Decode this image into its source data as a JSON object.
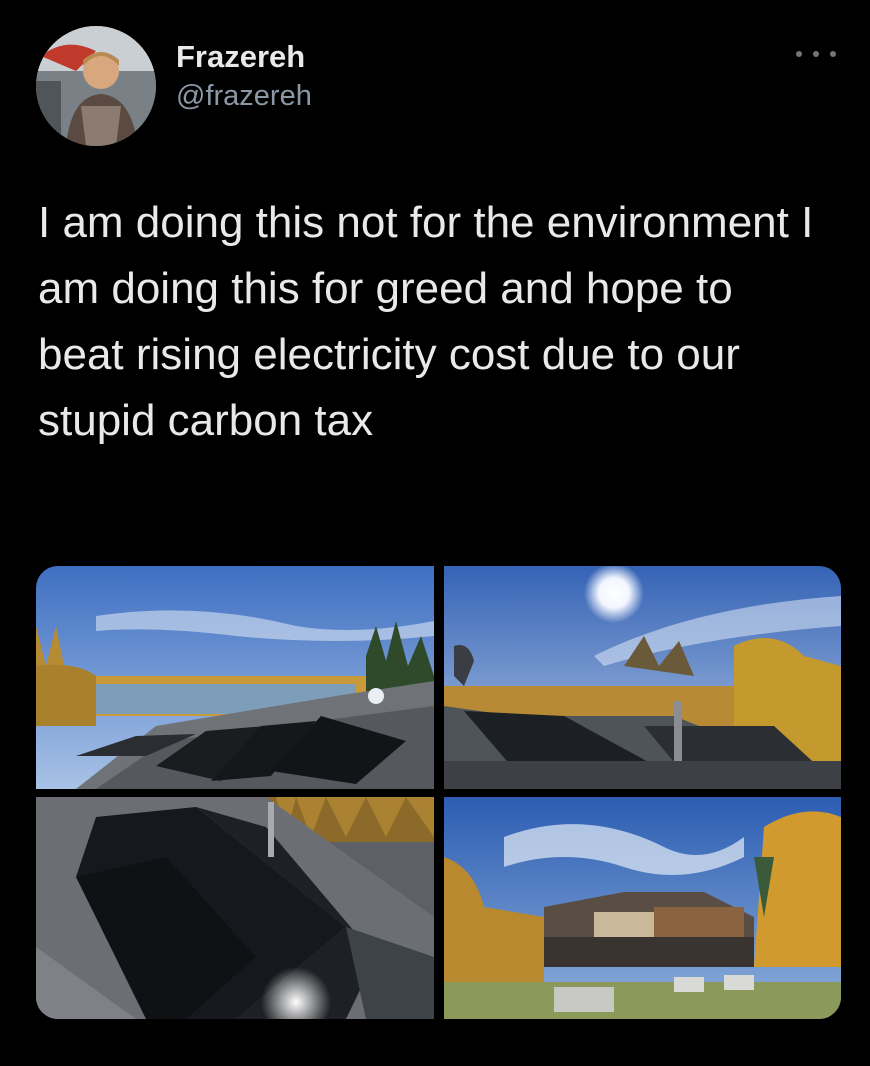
{
  "user": {
    "display_name": "Frazereh",
    "handle": "@frazereh",
    "avatar_icon": "user-avatar-photo"
  },
  "menu": {
    "icon": "more-options-icon"
  },
  "tweet": {
    "text": "I am doing this not for the environment I am doing this for greed and hope to beat rising electricity cost due to our stupid carbon tax"
  },
  "media": {
    "count": 4,
    "items": [
      {
        "subject": "roof solar panels with lake and autumn trees"
      },
      {
        "subject": "roof solar panels under bright sun"
      },
      {
        "subject": "close-up of solar panels on shingled roof"
      },
      {
        "subject": "house exterior with deck and autumn trees"
      }
    ]
  },
  "colors": {
    "background": "#000000",
    "text_primary": "#e7e9ea",
    "text_secondary": "#8b98a5"
  }
}
